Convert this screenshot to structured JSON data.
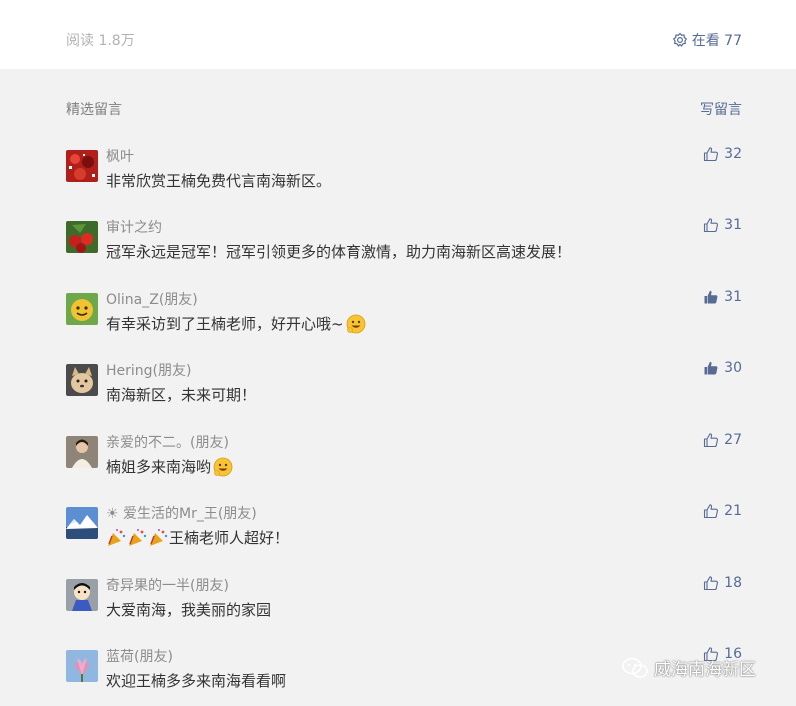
{
  "header": {
    "read_count": "阅读 1.8万",
    "watching": "在看 77"
  },
  "section": {
    "title": "精选留言",
    "write_label": "写留言"
  },
  "comments": [
    {
      "nick": "枫叶",
      "text": "非常欣赏王楠免费代言南海新区。",
      "likes": "32",
      "liked": false
    },
    {
      "nick": "审计之约",
      "text": "冠军永远是冠军！冠军引领更多的体育激情，助力南海新区高速发展！",
      "likes": "31",
      "liked": false
    },
    {
      "nick": "Olina_Z(朋友)",
      "text": "有幸采访到了王楠老师，好开心哦~",
      "likes": "31",
      "liked": true
    },
    {
      "nick": "Hering(朋友)",
      "text": "南海新区，未来可期！",
      "likes": "30",
      "liked": true
    },
    {
      "nick": "亲爱的不二。(朋友)",
      "text": "楠姐多来南海哟",
      "likes": "27",
      "liked": false
    },
    {
      "nick": "☀ 爱生活的Mr_王(朋友)",
      "text": "王楠老师人超好！",
      "likes": "21",
      "liked": false
    },
    {
      "nick": "奇异果的一半(朋友)",
      "text": "大爱南海，我美丽的家园",
      "likes": "18",
      "liked": false
    },
    {
      "nick": "蓝荷(朋友)",
      "text": "欢迎王楠多多来南海看看啊",
      "likes": "16",
      "liked": false
    }
  ],
  "watermark": {
    "text": "威海南海新区"
  },
  "colors": {
    "link": "#576b95",
    "muted": "#b2b2b2",
    "background": "#f2f2f2"
  }
}
